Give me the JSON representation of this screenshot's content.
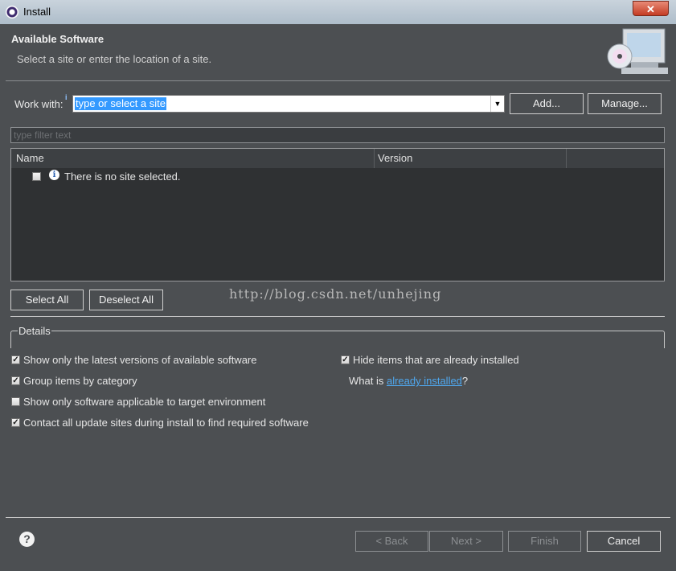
{
  "window": {
    "title": "Install",
    "close_symbol": "✕"
  },
  "header": {
    "title": "Available Software",
    "subtitle": "Select a site or enter the location of a site."
  },
  "work_with": {
    "label": "Work with:",
    "value": "type or select a site",
    "add_label": "Add...",
    "manage_label": "Manage..."
  },
  "filter": {
    "placeholder": "type filter text"
  },
  "table": {
    "columns": [
      "Name",
      "Version"
    ],
    "rows": [
      {
        "name": "There is no site selected.",
        "version": ""
      }
    ]
  },
  "buttons": {
    "select_all": "Select All",
    "deselect_all": "Deselect All"
  },
  "watermark": "http://blog.csdn.net/unhejing",
  "details": {
    "legend": "Details"
  },
  "options": {
    "latest": {
      "label": "Show only the latest versions of available software",
      "checked": true
    },
    "group": {
      "label": "Group items by category",
      "checked": true
    },
    "applicable": {
      "label": "Show only software applicable to target environment",
      "checked": false
    },
    "contact": {
      "label": "Contact all update sites during install to find required software",
      "checked": true
    },
    "hide": {
      "label": "Hide items that are already installed",
      "checked": true
    },
    "whatis_prefix": "What is ",
    "whatis_link": "already installed",
    "whatis_suffix": "?"
  },
  "footer": {
    "help": "?",
    "back": "< Back",
    "next": "Next >",
    "finish": "Finish",
    "cancel": "Cancel"
  },
  "colors": {
    "background": "#4c4f52",
    "selection": "#3399ff",
    "link": "#4fa8ef"
  }
}
